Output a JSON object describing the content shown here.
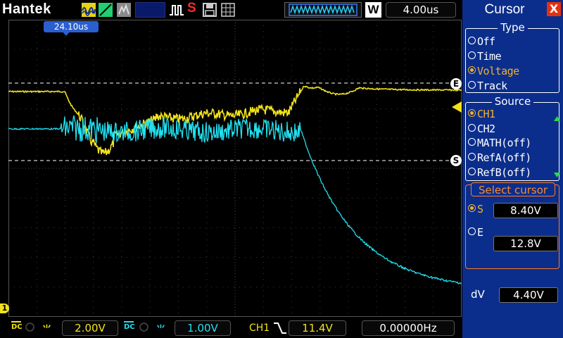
{
  "header": {
    "brand": "Hantek",
    "trigger_source_letter": "S",
    "timebase": "4.00us",
    "waveform_letter": "W"
  },
  "screen": {
    "trigger_time_label": "24.10us",
    "cursor_end_label": "E",
    "cursor_start_label": "S",
    "ground_marker_label": "1"
  },
  "bottom": {
    "ch1_coupling": "DC",
    "ch1_scale": "2.00V",
    "ch2_coupling": "DC",
    "ch2_scale": "1.00V",
    "trigger_channel": "CH1",
    "trigger_level": "11.4V",
    "frequency": "0.00000Hz"
  },
  "panel": {
    "title": "Cursor",
    "close_label": "X",
    "type_group": {
      "title": "Type",
      "options": [
        "Off",
        "Time",
        "Voltage",
        "Track"
      ],
      "selected": "Voltage"
    },
    "source_group": {
      "title": "Source",
      "options": [
        "CH1",
        "CH2",
        "MATH(off)",
        "RefA(off)",
        "RefB(off)"
      ],
      "selected": "CH1"
    },
    "select_cursor": {
      "title": "Select cursor",
      "s_label": "S",
      "s_value": "8.40V",
      "e_label": "E",
      "e_value": "12.8V",
      "selected": "S"
    },
    "dv_label": "dV",
    "dv_value": "4.40V"
  },
  "colors": {
    "ch1": "#f2e21a",
    "ch2": "#22e0f0",
    "panel_bg": "#0b2e8c",
    "selected_text": "#f0b030",
    "accent_orange": "#ff7a20"
  },
  "icons": {
    "ch1_icon": "sine-wave-icon",
    "ch2_icon": "ramp-icon",
    "math_icon": "grey-block-icon",
    "trigger_edge": "rising-edge-icon",
    "save": "floppy-disk-icon",
    "settings": "grid-settings-icon"
  }
}
